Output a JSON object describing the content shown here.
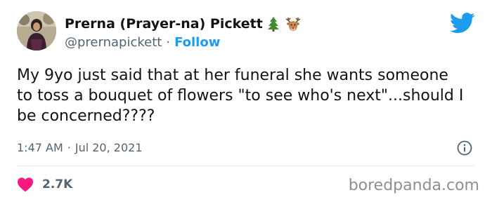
{
  "author": {
    "display_name": "Prerna (Prayer-na) Pickett",
    "emoji_icons": [
      "evergreen-tree-icon",
      "deer-icon"
    ],
    "handle": "@prernapickett",
    "separator": "·",
    "follow_label": "Follow"
  },
  "tweet": {
    "text": "My 9yo just said that at her funeral she wants someone to toss a bouquet of flowers \"to see who's next\"...should I be concerned????",
    "time": "1:47 AM",
    "separator": "·",
    "date": "Jul 20, 2021"
  },
  "engagement": {
    "likes": "2.7K"
  },
  "watermark": "boredpanda.com",
  "colors": {
    "twitter_blue": "#1d9bf0",
    "heart_pink": "#f91880",
    "secondary_text": "#536471",
    "primary_text": "#0f1419"
  }
}
